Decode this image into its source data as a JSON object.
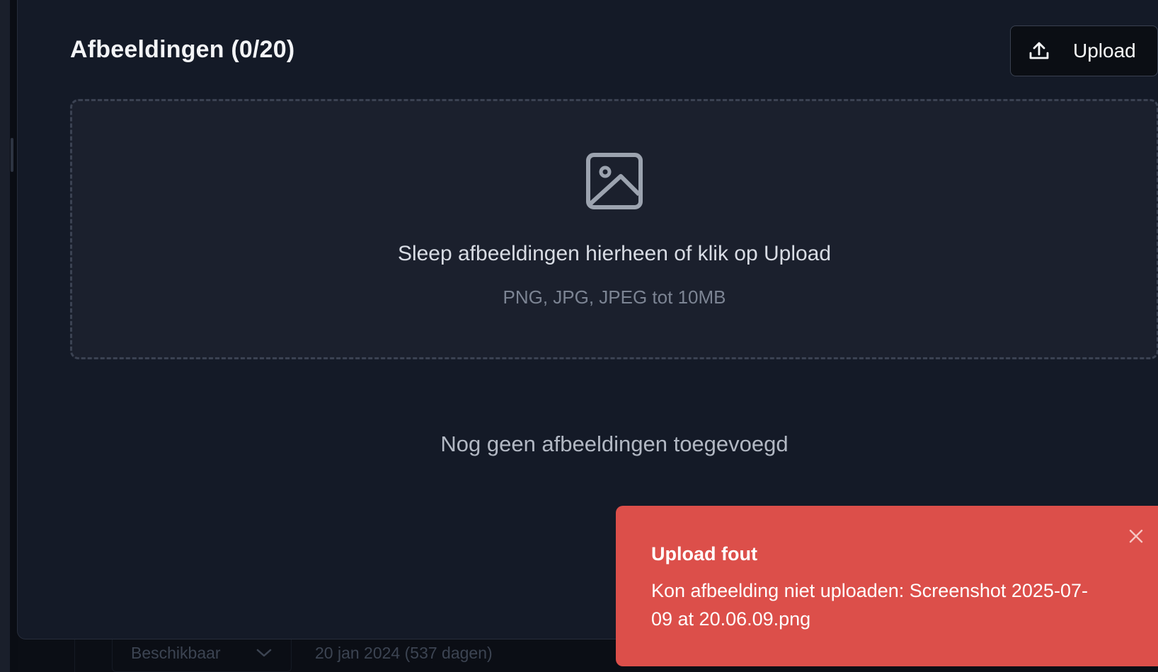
{
  "background_row": {
    "status_select_value": "Beschikbaar",
    "date_text": "20 jan 2024 (537 dagen)"
  },
  "dialog": {
    "title": "Afbeeldingen (0/20)",
    "upload_button_label": "Upload",
    "dropzone": {
      "icon": "image-icon",
      "title": "Sleep afbeeldingen hierheen of klik op Upload",
      "hint": "PNG, JPG, JPEG tot 10MB"
    },
    "empty_message": "Nog geen afbeeldingen toegevoegd"
  },
  "toast": {
    "title": "Upload fout",
    "message": "Kon afbeelding niet uploaden: Screenshot 2025-07-09 at 20.06.09.png",
    "close_icon": "close-icon",
    "color": "#dc4f4a"
  },
  "colors": {
    "dialog_background": "#141a27",
    "dropzone_background": "#1b202d",
    "dropzone_border": "#3b4252",
    "button_background": "#0b0e14"
  }
}
